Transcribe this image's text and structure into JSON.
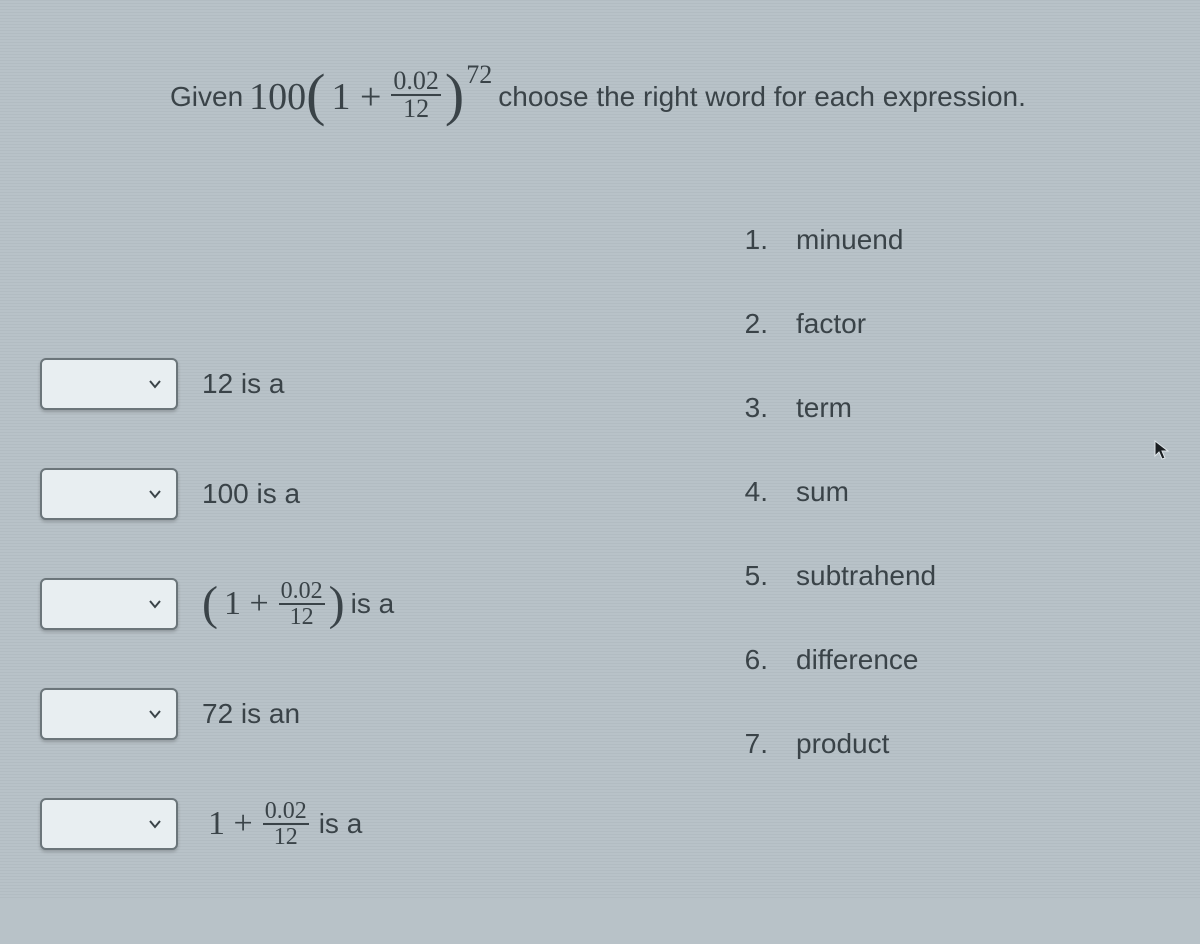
{
  "prompt": {
    "prefix": "Given",
    "coefficient": "100",
    "open": "(",
    "one_plus": "1 +",
    "frac_num": "0.02",
    "frac_den": "12",
    "close": ")",
    "exponent": "72",
    "suffix": "choose the right word for each expression."
  },
  "rows": [
    {
      "type": "text",
      "label": "12 is a"
    },
    {
      "type": "text",
      "label": "100 is a"
    },
    {
      "type": "paren_frac",
      "open": "(",
      "one_plus": "1 +",
      "num": "0.02",
      "den": "12",
      "close": ")",
      "tail": "is a"
    },
    {
      "type": "text",
      "label": "72 is an"
    },
    {
      "type": "plain_frac",
      "one_plus": "1 +",
      "num": "0.02",
      "den": "12",
      "tail": "is a"
    }
  ],
  "words": [
    {
      "n": "1.",
      "w": "minuend"
    },
    {
      "n": "2.",
      "w": "factor"
    },
    {
      "n": "3.",
      "w": "term"
    },
    {
      "n": "4.",
      "w": "sum"
    },
    {
      "n": "5.",
      "w": "subtrahend"
    },
    {
      "n": "6.",
      "w": "difference"
    },
    {
      "n": "7.",
      "w": "product"
    }
  ]
}
